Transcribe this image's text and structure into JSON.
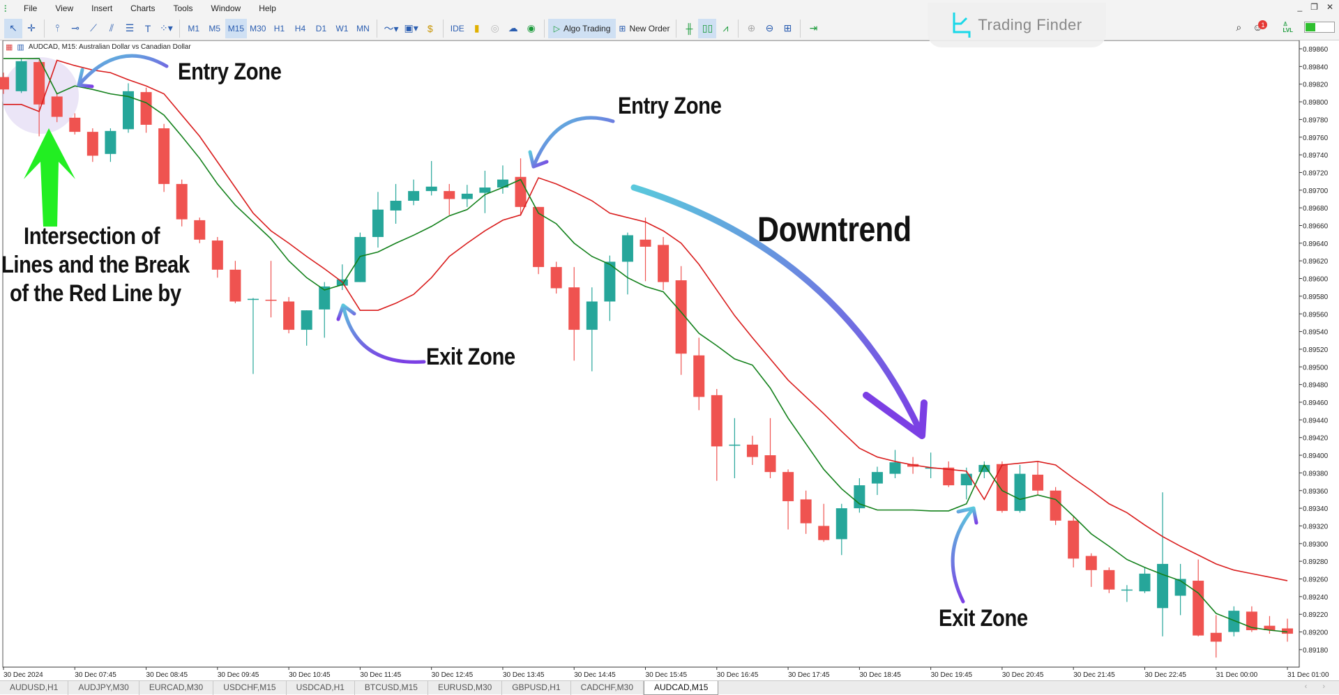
{
  "menu": [
    "File",
    "View",
    "Insert",
    "Charts",
    "Tools",
    "Window",
    "Help"
  ],
  "toolbar": {
    "timeframes": [
      "M1",
      "M5",
      "M15",
      "M30",
      "H1",
      "H4",
      "D1",
      "W1",
      "MN"
    ],
    "active_timeframe": "M15",
    "ide": "IDE",
    "algo_trading": "Algo Trading",
    "new_order": "New Order",
    "notification_count": "1",
    "lvl": "LVL"
  },
  "watermark": "Trading Finder",
  "chart_title": "AUDCAD, M15:  Australian Dollar vs Canadian Dollar",
  "annotations": {
    "entry1": "Entry Zone",
    "entry2": "Entry Zone",
    "downtrend": "Downtrend",
    "exit1": "Exit Zone",
    "exit2": "Exit Zone",
    "intersection": [
      "Intersection of",
      "Lines and the Break",
      "of the Red Line by"
    ]
  },
  "colors": {
    "bull": "#26a69a",
    "bear": "#ef5350",
    "red_line": "#d91c1c",
    "green_line": "#12801a",
    "arrow_cyan": "#5ac8dc",
    "arrow_purple": "#7b3fe4",
    "arrow_green": "#22ee22"
  },
  "chart_data": {
    "type": "candlestick",
    "symbol": "AUDCAD",
    "timeframe": "M15",
    "ylim": [
      0.8917,
      0.8987
    ],
    "price_ticks": [
      0.8986,
      0.8984,
      0.8982,
      0.898,
      0.8978,
      0.8976,
      0.8974,
      0.8972,
      0.897,
      0.8968,
      0.8966,
      0.8964,
      0.8962,
      0.896,
      0.8958,
      0.8956,
      0.8954,
      0.8952,
      0.895,
      0.8948,
      0.8946,
      0.8944,
      0.8942,
      0.894,
      0.8938,
      0.8936,
      0.8934,
      0.8932,
      0.893,
      0.8928,
      0.8926,
      0.8924,
      0.8922,
      0.892,
      0.8918
    ],
    "time_labels": [
      "30 Dec 2024",
      "30 Dec 07:45",
      "30 Dec 08:45",
      "30 Dec 09:45",
      "30 Dec 10:45",
      "30 Dec 11:45",
      "30 Dec 12:45",
      "30 Dec 13:45",
      "30 Dec 14:45",
      "30 Dec 15:45",
      "30 Dec 16:45",
      "30 Dec 17:45",
      "30 Dec 18:45",
      "30 Dec 19:45",
      "30 Dec 20:45",
      "30 Dec 21:45",
      "30 Dec 22:45",
      "31 Dec 00:00",
      "31 Dec 01:00"
    ],
    "ohlc": [
      [
        0.89828,
        0.89833,
        0.89809,
        0.89814
      ],
      [
        0.89812,
        0.89849,
        0.8981,
        0.89846
      ],
      [
        0.89845,
        0.89847,
        0.89761,
        0.89797
      ],
      [
        0.89806,
        0.89809,
        0.89777,
        0.89783
      ],
      [
        0.89782,
        0.89787,
        0.89763,
        0.89766
      ],
      [
        0.89766,
        0.8977,
        0.89732,
        0.89739
      ],
      [
        0.89741,
        0.8977,
        0.89732,
        0.89767
      ],
      [
        0.89769,
        0.89821,
        0.89765,
        0.89812
      ],
      [
        0.89811,
        0.89816,
        0.89765,
        0.89774
      ],
      [
        0.8977,
        0.89775,
        0.89698,
        0.89707
      ],
      [
        0.89707,
        0.89712,
        0.89659,
        0.89667
      ],
      [
        0.89666,
        0.89669,
        0.8964,
        0.89644
      ],
      [
        0.89643,
        0.89647,
        0.89601,
        0.8961
      ],
      [
        0.8961,
        0.8962,
        0.89572,
        0.89574
      ],
      [
        0.89576,
        0.89578,
        0.89492,
        0.89577
      ],
      [
        0.89576,
        0.8962,
        0.89556,
        0.89575
      ],
      [
        0.89574,
        0.89579,
        0.89538,
        0.89542
      ],
      [
        0.89542,
        0.89564,
        0.89524,
        0.89564
      ],
      [
        0.89565,
        0.89596,
        0.89533,
        0.89591
      ],
      [
        0.89592,
        0.89616,
        0.89587,
        0.89599
      ],
      [
        0.89596,
        0.89652,
        0.89596,
        0.89647
      ],
      [
        0.89647,
        0.89698,
        0.89635,
        0.89678
      ],
      [
        0.89677,
        0.89707,
        0.89662,
        0.89688
      ],
      [
        0.89688,
        0.89712,
        0.89683,
        0.89699
      ],
      [
        0.89699,
        0.89733,
        0.89694,
        0.89704
      ],
      [
        0.89699,
        0.89707,
        0.89672,
        0.8969
      ],
      [
        0.8969,
        0.89706,
        0.89681,
        0.89696
      ],
      [
        0.89697,
        0.89722,
        0.89674,
        0.89703
      ],
      [
        0.89703,
        0.89728,
        0.89696,
        0.89712
      ],
      [
        0.89715,
        0.89736,
        0.89671,
        0.89681
      ],
      [
        0.89681,
        0.89681,
        0.89605,
        0.89613
      ],
      [
        0.89613,
        0.89619,
        0.89583,
        0.89589
      ],
      [
        0.8959,
        0.89613,
        0.89507,
        0.89542
      ],
      [
        0.89542,
        0.8959,
        0.89495,
        0.89574
      ],
      [
        0.89574,
        0.89626,
        0.89552,
        0.89619
      ],
      [
        0.89619,
        0.89652,
        0.89582,
        0.89649
      ],
      [
        0.89644,
        0.89669,
        0.89597,
        0.89636
      ],
      [
        0.89638,
        0.89647,
        0.89587,
        0.89596
      ],
      [
        0.89598,
        0.89614,
        0.89491,
        0.89515
      ],
      [
        0.89513,
        0.89533,
        0.89451,
        0.89466
      ],
      [
        0.89468,
        0.89475,
        0.89371,
        0.8941
      ],
      [
        0.89411,
        0.89442,
        0.89374,
        0.89412
      ],
      [
        0.89412,
        0.89422,
        0.89389,
        0.89398
      ],
      [
        0.894,
        0.89442,
        0.89374,
        0.89381
      ],
      [
        0.89381,
        0.89384,
        0.89316,
        0.89348
      ],
      [
        0.8935,
        0.8936,
        0.89311,
        0.89323
      ],
      [
        0.8932,
        0.89345,
        0.89302,
        0.89304
      ],
      [
        0.89305,
        0.89345,
        0.89287,
        0.8934
      ],
      [
        0.8934,
        0.89374,
        0.89335,
        0.89366
      ],
      [
        0.89368,
        0.89387,
        0.89355,
        0.89381
      ],
      [
        0.89379,
        0.89406,
        0.89374,
        0.89392
      ],
      [
        0.8939,
        0.89398,
        0.89379,
        0.89387
      ],
      [
        0.89385,
        0.89403,
        0.89374,
        0.89386
      ],
      [
        0.89386,
        0.89393,
        0.89364,
        0.89366
      ],
      [
        0.89366,
        0.89386,
        0.8935,
        0.89379
      ],
      [
        0.89381,
        0.89393,
        0.89374,
        0.89389
      ],
      [
        0.8939,
        0.89393,
        0.89335,
        0.89337
      ],
      [
        0.89337,
        0.89389,
        0.89335,
        0.89379
      ],
      [
        0.89378,
        0.89393,
        0.89355,
        0.8936
      ],
      [
        0.8936,
        0.89364,
        0.89321,
        0.89326
      ],
      [
        0.89326,
        0.89331,
        0.89273,
        0.89283
      ],
      [
        0.89286,
        0.89289,
        0.89251,
        0.8927
      ],
      [
        0.8927,
        0.89273,
        0.89244,
        0.89248
      ],
      [
        0.89247,
        0.89253,
        0.89234,
        0.89248
      ],
      [
        0.89246,
        0.89273,
        0.89244,
        0.89266
      ],
      [
        0.89227,
        0.89358,
        0.89195,
        0.89277
      ],
      [
        0.89241,
        0.89277,
        0.89219,
        0.8926
      ],
      [
        0.89258,
        0.89282,
        0.89195,
        0.89196
      ],
      [
        0.89199,
        0.89219,
        0.89171,
        0.89189
      ],
      [
        0.892,
        0.89229,
        0.89195,
        0.89224
      ],
      [
        0.89223,
        0.89229,
        0.892,
        0.89202
      ],
      [
        0.89207,
        0.89218,
        0.89198,
        0.89202
      ],
      [
        0.89204,
        0.89215,
        0.89189,
        0.89198
      ]
    ],
    "red_line": [
      0.89797,
      0.89797,
      0.89789,
      0.89847,
      0.89841,
      0.89836,
      0.89833,
      0.89825,
      0.89818,
      0.89809,
      0.89785,
      0.89761,
      0.89732,
      0.89703,
      0.89674,
      0.89654,
      0.8964,
      0.89625,
      0.89611,
      0.89596,
      0.89564,
      0.89564,
      0.89572,
      0.89582,
      0.89601,
      0.89625,
      0.8964,
      0.89654,
      0.89666,
      0.89672,
      0.89714,
      0.89707,
      0.89698,
      0.89688,
      0.89674,
      0.89669,
      0.89664,
      0.89654,
      0.8964,
      0.89616,
      0.89587,
      0.89558,
      0.89533,
      0.89509,
      0.89485,
      0.89466,
      0.89447,
      0.89427,
      0.89408,
      0.89398,
      0.89393,
      0.89389,
      0.89386,
      0.89384,
      0.89382,
      0.8935,
      0.89389,
      0.89391,
      0.89393,
      0.89389,
      0.89374,
      0.8936,
      0.89345,
      0.89335,
      0.89321,
      0.89308,
      0.89297,
      0.89287,
      0.89277,
      0.8927,
      0.89266,
      0.89262,
      0.89258
    ],
    "green_line": [
      0.89849,
      0.89849,
      0.89849,
      0.89809,
      0.89818,
      0.89814,
      0.89809,
      0.89806,
      0.89799,
      0.89785,
      0.89761,
      0.89736,
      0.89707,
      0.89683,
      0.89664,
      0.89645,
      0.8962,
      0.89601,
      0.89587,
      0.89593,
      0.89625,
      0.8963,
      0.8964,
      0.89649,
      0.89659,
      0.89671,
      0.89678,
      0.89695,
      0.89703,
      0.89712,
      0.89674,
      0.89662,
      0.8964,
      0.89625,
      0.89616,
      0.89601,
      0.89591,
      0.89585,
      0.89562,
      0.89538,
      0.89524,
      0.89509,
      0.89502,
      0.89476,
      0.89442,
      0.89413,
      0.89384,
      0.89362,
      0.89345,
      0.89338,
      0.89338,
      0.89338,
      0.89337,
      0.89337,
      0.89345,
      0.89389,
      0.8936,
      0.8935,
      0.89355,
      0.8935,
      0.89331,
      0.89311,
      0.89297,
      0.89282,
      0.89273,
      0.89265,
      0.89258,
      0.89244,
      0.89221,
      0.89213,
      0.89205,
      0.89202,
      0.892
    ]
  },
  "tabs": [
    "AUDUSD,H1",
    "AUDJPY,M30",
    "EURCAD,M30",
    "USDCHF,M15",
    "USDCAD,H1",
    "BTCUSD,M15",
    "EURUSD,M30",
    "GBPUSD,H1",
    "CADCHF,M30",
    "AUDCAD,M15"
  ],
  "active_tab": "AUDCAD,M15"
}
